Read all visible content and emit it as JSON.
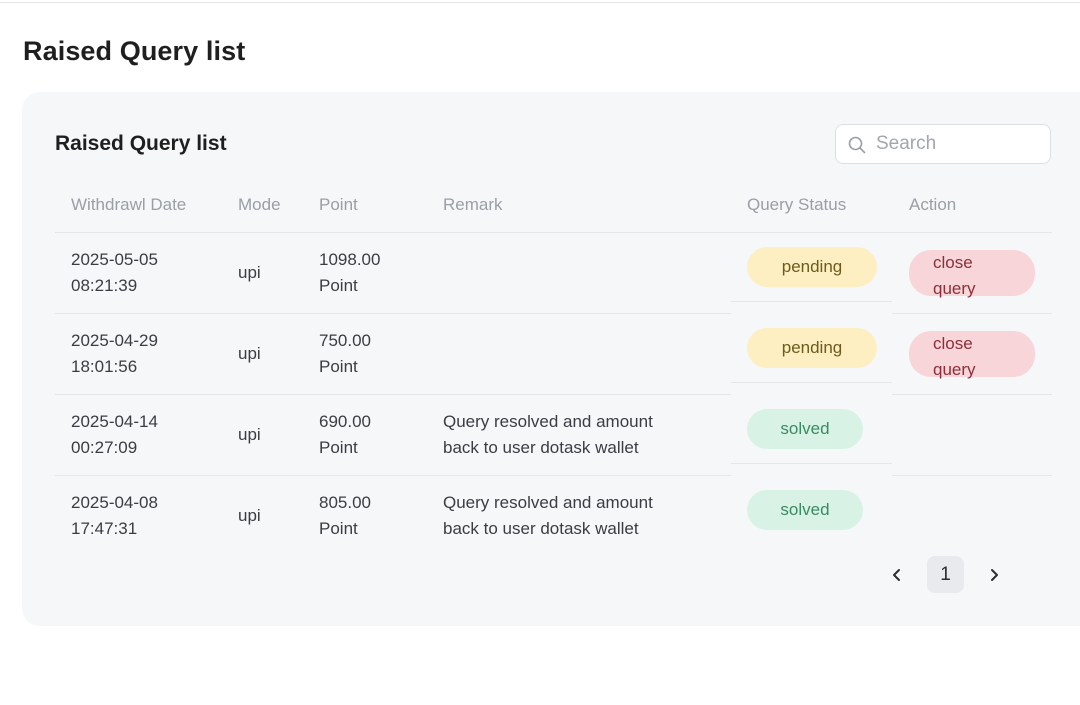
{
  "page": {
    "title": "Raised Query list"
  },
  "card": {
    "title": "Raised Query list",
    "search": {
      "placeholder": "Search",
      "value": ""
    }
  },
  "table": {
    "headers": [
      "Withdrawl Date",
      "Mode",
      "Point",
      "Remark",
      "Query Status",
      "Action"
    ],
    "rows": [
      {
        "date": "2025-05-05",
        "time": "08:21:39",
        "mode": "upi",
        "amount": "1098.00",
        "unit": "Point",
        "remark1": "",
        "remark2": "",
        "status": "pending",
        "action1": "close",
        "action2": "query"
      },
      {
        "date": "2025-04-29",
        "time": "18:01:56",
        "mode": "upi",
        "amount": "750.00",
        "unit": "Point",
        "remark1": "",
        "remark2": "",
        "status": "pending",
        "action1": "close",
        "action2": "query"
      },
      {
        "date": "2025-04-14",
        "time": "00:27:09",
        "mode": "upi",
        "amount": "690.00",
        "unit": "Point",
        "remark1": "Query resolved and amount",
        "remark2": "back to user dotask wallet",
        "status": "solved",
        "action1": "",
        "action2": ""
      },
      {
        "date": "2025-04-08",
        "time": "17:47:31",
        "mode": "upi",
        "amount": "805.00",
        "unit": "Point",
        "remark1": "Query resolved and amount",
        "remark2": "back to user dotask wallet",
        "status": "solved",
        "action1": "",
        "action2": ""
      }
    ]
  },
  "pagination": {
    "current_page": "1"
  },
  "icons": {
    "search": "search-icon",
    "prev": "chevron-left-icon",
    "next": "chevron-right-icon"
  },
  "colors": {
    "pending_bg": "#fdefc2",
    "solved_bg": "#d8f3e6",
    "close_query_bg": "#f8d5d9"
  }
}
